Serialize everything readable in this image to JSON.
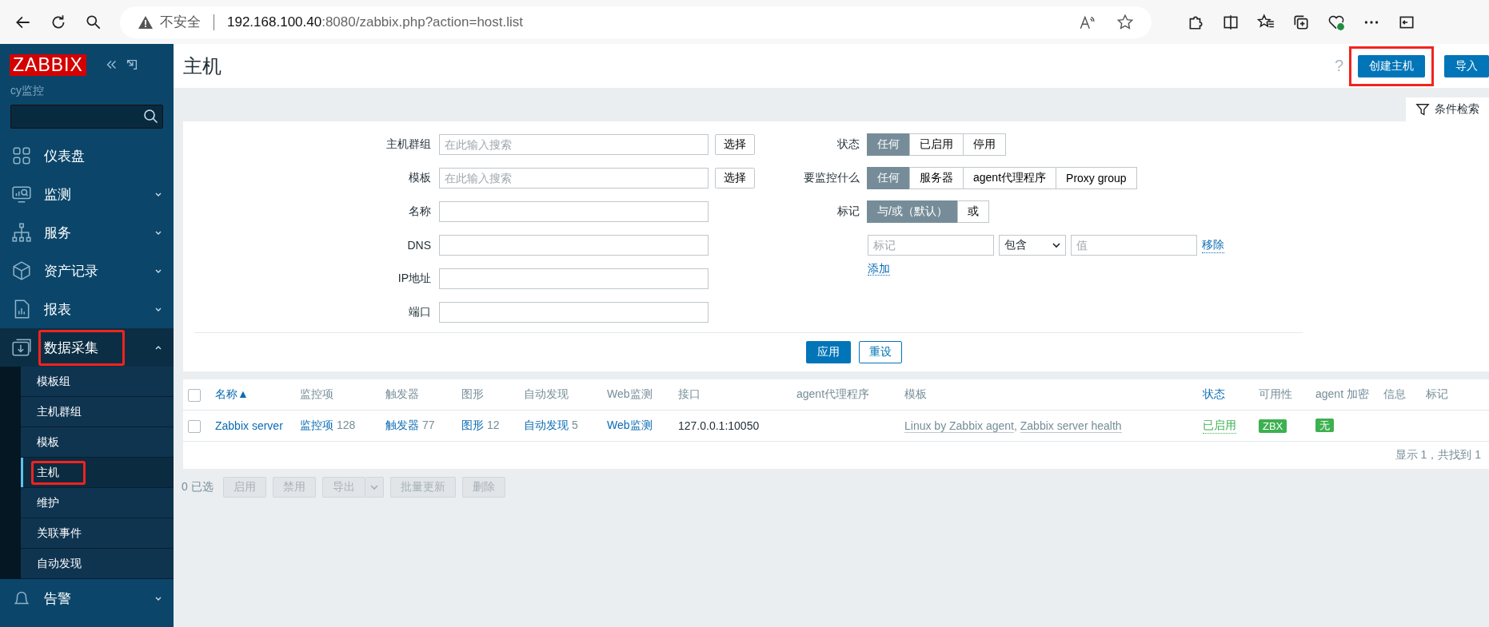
{
  "browser": {
    "security_label": "不安全",
    "url_host": "192.168.100.40",
    "url_rest": ":8080/zabbix.php?action=host.list"
  },
  "sidebar": {
    "logo": "ZABBIX",
    "server_name": "cy监控",
    "items": [
      {
        "label": "仪表盘",
        "has_children": false,
        "expanded": false,
        "highlighted": false
      },
      {
        "label": "监测",
        "has_children": true,
        "expanded": false,
        "highlighted": false
      },
      {
        "label": "服务",
        "has_children": true,
        "expanded": false,
        "highlighted": false
      },
      {
        "label": "资产记录",
        "has_children": true,
        "expanded": false,
        "highlighted": false
      },
      {
        "label": "报表",
        "has_children": true,
        "expanded": false,
        "highlighted": false
      },
      {
        "label": "数据采集",
        "has_children": true,
        "expanded": true,
        "highlighted": true,
        "children": [
          {
            "label": "模板组",
            "selected": false,
            "highlighted": false
          },
          {
            "label": "主机群组",
            "selected": false,
            "highlighted": false
          },
          {
            "label": "模板",
            "selected": false,
            "highlighted": false
          },
          {
            "label": "主机",
            "selected": true,
            "highlighted": true
          },
          {
            "label": "维护",
            "selected": false,
            "highlighted": false
          },
          {
            "label": "关联事件",
            "selected": false,
            "highlighted": false
          },
          {
            "label": "自动发现",
            "selected": false,
            "highlighted": false
          }
        ]
      },
      {
        "label": "告警",
        "has_children": true,
        "expanded": false,
        "highlighted": false
      }
    ]
  },
  "header": {
    "title": "主机",
    "help": "?",
    "buttons": [
      {
        "label": "创建主机",
        "highlighted": true
      },
      {
        "label": "导入",
        "highlighted": false
      }
    ]
  },
  "filter": {
    "tab_label": "条件检索",
    "left_fields": [
      {
        "label": "主机群组",
        "placeholder": "在此输入搜索",
        "select_button": "选择"
      },
      {
        "label": "模板",
        "placeholder": "在此输入搜索",
        "select_button": "选择"
      },
      {
        "label": "名称"
      },
      {
        "label": "DNS"
      },
      {
        "label": "IP地址"
      },
      {
        "label": "端口"
      }
    ],
    "segments": [
      {
        "label": "状态",
        "options": [
          {
            "label": "任何",
            "selected": true
          },
          {
            "label": "已启用",
            "selected": false
          },
          {
            "label": "停用",
            "selected": false
          }
        ]
      },
      {
        "label": "要监控什么",
        "options": [
          {
            "label": "任何",
            "selected": true
          },
          {
            "label": "服务器",
            "selected": false
          },
          {
            "label": "agent代理程序",
            "selected": false
          },
          {
            "label": "Proxy group",
            "selected": false
          }
        ]
      },
      {
        "label": "标记",
        "options": [
          {
            "label": "与/或（默认）",
            "selected": true
          },
          {
            "label": "或",
            "selected": false
          }
        ]
      }
    ],
    "tag_row": {
      "tag_placeholder": "标记",
      "operator": "包含",
      "value_placeholder": "值",
      "remove": "移除"
    },
    "add_link": "添加",
    "apply": "应用",
    "reset": "重设"
  },
  "table": {
    "select_all_checked": false,
    "template_separator": ", ",
    "columns": [
      {
        "label": "名称",
        "link": true,
        "sort": "▲"
      },
      {
        "label": "监控项",
        "link": false
      },
      {
        "label": "触发器",
        "link": false
      },
      {
        "label": "图形",
        "link": false
      },
      {
        "label": "自动发现",
        "link": false
      },
      {
        "label": "Web监测",
        "link": false
      },
      {
        "label": "接口",
        "link": false
      },
      {
        "label": "agent代理程序",
        "link": false
      },
      {
        "label": "模板",
        "link": false
      },
      {
        "label": "状态",
        "link": true
      },
      {
        "label": "可用性",
        "link": false
      },
      {
        "label": "agent 加密",
        "link": false
      },
      {
        "label": "信息",
        "link": false
      },
      {
        "label": "标记",
        "link": false
      }
    ],
    "rows": [
      {
        "checked": false,
        "name": "Zabbix server",
        "counts": [
          {
            "label": "监控项",
            "count": "128"
          },
          {
            "label": "触发器",
            "count": "77"
          },
          {
            "label": "图形",
            "count": "12"
          },
          {
            "label": "自动发现",
            "count": "5"
          }
        ],
        "web": "Web监测",
        "interface": "127.0.0.1:10050",
        "templates": [
          "Linux by Zabbix agent",
          "Zabbix server health"
        ],
        "status": "已启用",
        "availability": {
          "label": "ZBX",
          "color": "#3db050"
        },
        "encryption": {
          "label": "无",
          "color": "#3db050"
        }
      }
    ],
    "footer": "显示 1，共找到 1"
  },
  "actions": {
    "selected_count": "0 已选",
    "buttons": [
      {
        "label": "启用",
        "disabled": true,
        "dropdown": false
      },
      {
        "label": "禁用",
        "disabled": true,
        "dropdown": false
      },
      {
        "label": "导出",
        "disabled": true,
        "dropdown": true
      },
      {
        "label": "批量更新",
        "disabled": true,
        "dropdown": false
      },
      {
        "label": "删除",
        "disabled": true,
        "dropdown": false
      }
    ]
  }
}
